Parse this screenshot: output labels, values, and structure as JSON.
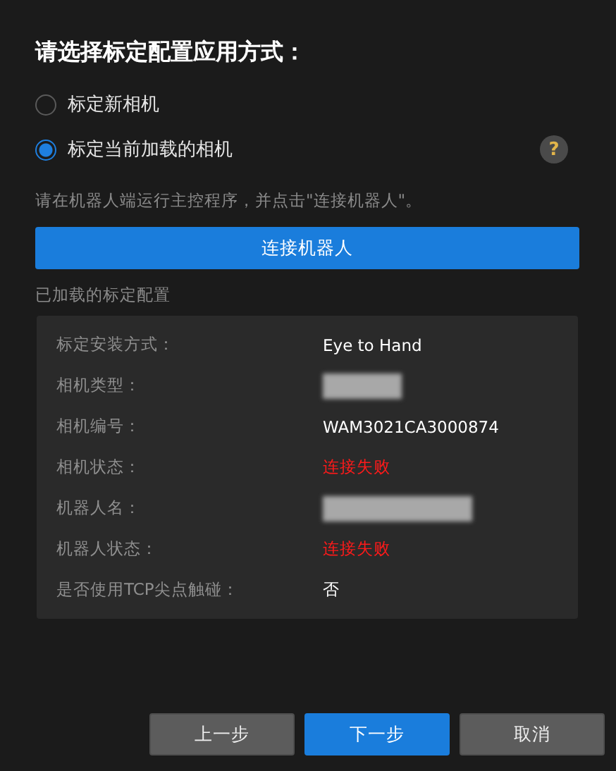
{
  "title": "请选择标定配置应用方式：",
  "options": [
    {
      "label": "标定新相机",
      "selected": false
    },
    {
      "label": "标定当前加载的相机",
      "selected": true
    }
  ],
  "help": "?",
  "hint": "请在机器人端运行主控程序，并点击\"连接机器人\"。",
  "connect_button": "连接机器人",
  "config": {
    "heading": "已加载的标定配置",
    "rows": [
      {
        "label": "标定安装方式：",
        "kind": "text",
        "value": "Eye to Hand"
      },
      {
        "label": "相机类型：",
        "kind": "redacted"
      },
      {
        "label": "相机编号：",
        "kind": "text",
        "value": "WAM3021CA3000874"
      },
      {
        "label": "相机状态：",
        "kind": "error",
        "value": "连接失败"
      },
      {
        "label": "机器人名：",
        "kind": "redacted"
      },
      {
        "label": "机器人状态：",
        "kind": "error",
        "value": "连接失败"
      },
      {
        "label": "是否使用TCP尖点触碰：",
        "kind": "text",
        "value": "否"
      }
    ]
  },
  "buttons": [
    {
      "label": "上一步",
      "kind": "secondary"
    },
    {
      "label": "下一步",
      "kind": "primary"
    },
    {
      "label": "取消",
      "kind": "secondary"
    }
  ]
}
